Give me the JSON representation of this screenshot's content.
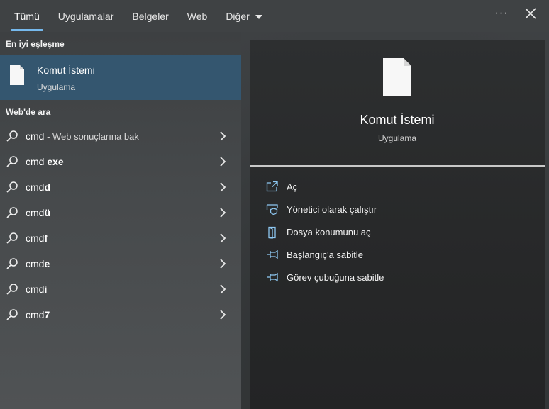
{
  "tabs": [
    {
      "label": "Tümü",
      "active": true
    },
    {
      "label": "Uygulamalar",
      "active": false
    },
    {
      "label": "Belgeler",
      "active": false
    },
    {
      "label": "Web",
      "active": false
    },
    {
      "label": "Diğer",
      "active": false
    }
  ],
  "toolbar": {
    "more_label": "···"
  },
  "best_match": {
    "header": "En iyi eşleşme",
    "title": "Komut İstemi",
    "subtitle": "Uygulama"
  },
  "web_search": {
    "header": "Web'de ara",
    "items": [
      {
        "prefix": "cmd",
        "bold": "",
        "hint": " - Web sonuçlarına bak"
      },
      {
        "prefix": "cmd ",
        "bold": "exe",
        "hint": ""
      },
      {
        "prefix": "cmd",
        "bold": "d",
        "hint": ""
      },
      {
        "prefix": "cmd",
        "bold": "ü",
        "hint": ""
      },
      {
        "prefix": "cmd",
        "bold": "f",
        "hint": ""
      },
      {
        "prefix": "cmd",
        "bold": "e",
        "hint": ""
      },
      {
        "prefix": "cmd",
        "bold": "i",
        "hint": ""
      },
      {
        "prefix": "cmd",
        "bold": "7",
        "hint": ""
      }
    ]
  },
  "preview": {
    "title": "Komut İstemi",
    "subtitle": "Uygulama",
    "actions": [
      {
        "label": "Aç",
        "icon": "open-icon"
      },
      {
        "label": "Yönetici olarak çalıştır",
        "icon": "shield-icon"
      },
      {
        "label": "Dosya konumunu aç",
        "icon": "folder-icon"
      },
      {
        "label": "Başlangıç'a sabitle",
        "icon": "pin-icon"
      },
      {
        "label": "Görev çubuğuna sabitle",
        "icon": "pin-icon"
      }
    ]
  },
  "colors": {
    "accent": "#76b9ed",
    "selected_bg": "#34566f"
  }
}
